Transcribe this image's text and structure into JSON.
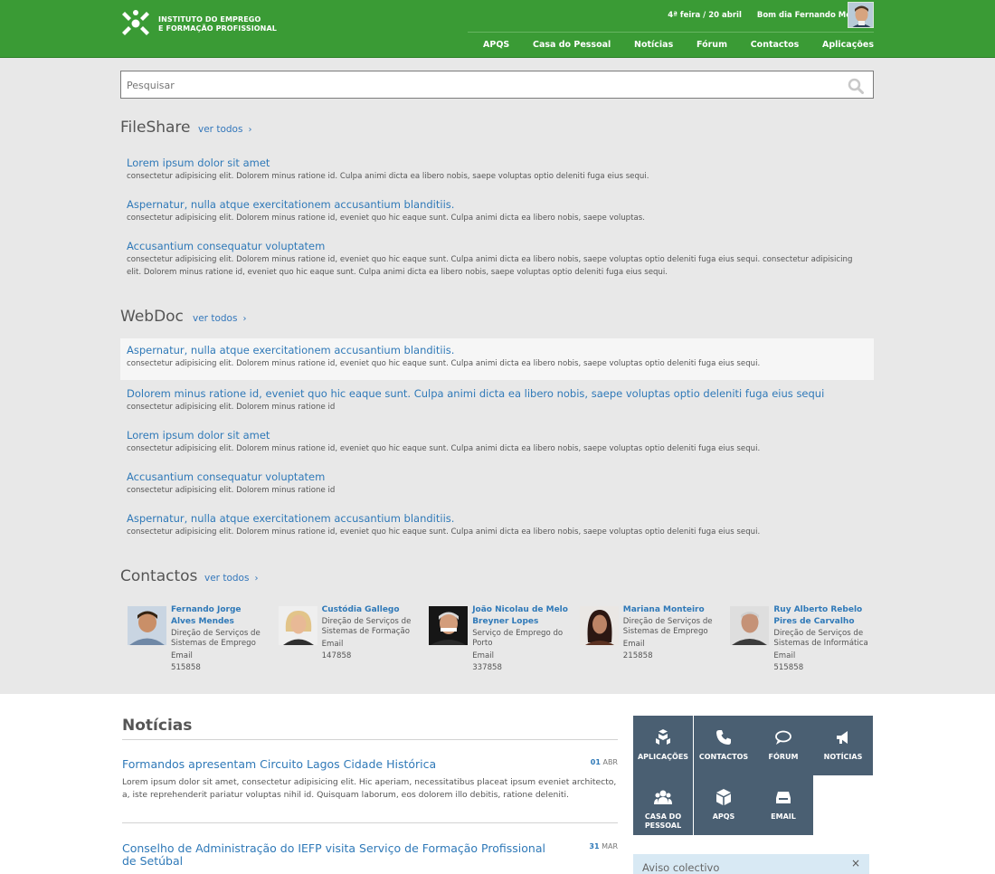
{
  "header": {
    "logo_line_1": "INSTITUTO DO EMPREGO",
    "logo_line_2": "E FORMAÇÃO PROFISSIONAL",
    "date": "4ª feira / 20 abril",
    "greeting": "Bom dia Fernando Mendes",
    "nav": [
      "APQS",
      "Casa do Pessoal",
      "Notícias",
      "Fórum",
      "Contactos",
      "Aplicações"
    ],
    "brand_color": "#3a9b35"
  },
  "search": {
    "placeholder": "Pesquisar"
  },
  "fileshare": {
    "title": "FileShare",
    "view_all": "ver todos",
    "items": [
      {
        "title": "Lorem ipsum dolor sit amet",
        "desc": "consectetur adipisicing elit. Dolorem minus ratione id. Culpa animi dicta ea libero nobis, saepe voluptas optio deleniti fuga eius sequi."
      },
      {
        "title": "Aspernatur, nulla atque exercitationem accusantium blanditiis.",
        "desc": "consectetur adipisicing elit. Dolorem minus ratione id, eveniet quo hic eaque sunt. Culpa animi dicta ea libero nobis, saepe voluptas."
      },
      {
        "title": "Accusantium consequatur voluptatem",
        "desc": "consectetur adipisicing elit. Dolorem minus ratione id, eveniet quo hic eaque sunt. Culpa animi dicta ea libero nobis, saepe voluptas optio deleniti fuga eius sequi. consectetur adipisicing elit. Dolorem minus ratione id, eveniet quo hic eaque sunt. Culpa animi dicta ea libero nobis, saepe voluptas optio deleniti fuga eius sequi."
      }
    ]
  },
  "webdoc": {
    "title": "WebDoc",
    "view_all": "ver todos",
    "items": [
      {
        "title": "Aspernatur, nulla atque exercitationem accusantium blanditiis.",
        "desc": "consectetur adipisicing elit. Dolorem minus ratione id, eveniet quo hic eaque sunt. Culpa animi dicta ea libero nobis, saepe voluptas optio deleniti fuga eius sequi."
      },
      {
        "title": "Dolorem minus ratione id, eveniet quo hic eaque sunt. Culpa animi dicta ea libero nobis, saepe voluptas optio deleniti fuga eius sequi",
        "desc": "consectetur adipisicing elit. Dolorem minus ratione id"
      },
      {
        "title": "Lorem ipsum dolor sit amet",
        "desc": "consectetur adipisicing elit. Dolorem minus ratione id, eveniet quo hic eaque sunt. Culpa animi dicta ea libero nobis, saepe voluptas optio deleniti fuga eius sequi."
      },
      {
        "title": "Accusantium consequatur voluptatem",
        "desc": "consectetur adipisicing elit. Dolorem minus ratione id"
      },
      {
        "title": "Aspernatur, nulla atque exercitationem accusantium blanditiis.",
        "desc": "consectetur adipisicing elit. Dolorem minus ratione id, eveniet quo hic eaque sunt. Culpa animi dicta ea libero nobis, saepe voluptas optio deleniti fuga eius sequi."
      }
    ]
  },
  "contacts": {
    "title": "Contactos",
    "view_all": "ver todos",
    "people": [
      {
        "name": "Fernando Jorge Alves Mendes",
        "dept": "Direção de Serviços de Sistemas de Emprego",
        "email": "Email",
        "phone": "515858"
      },
      {
        "name": "Custódia Gallego",
        "dept": "Direção de Serviços de Sistemas de Formação",
        "email": "Email",
        "phone": "147858"
      },
      {
        "name": "João Nicolau de Melo Breyner Lopes",
        "dept": "Serviço de Emprego do Porto",
        "email": "Email",
        "phone": "337858"
      },
      {
        "name": "Mariana Monteiro",
        "dept": "Direção de Serviços de Sistemas de Emprego",
        "email": "Email",
        "phone": "215858"
      },
      {
        "name": "Ruy Alberto Rebelo Pires de Carvalho",
        "dept": "Direção de Serviços de Sistemas de Informática",
        "email": "Email",
        "phone": "515858"
      }
    ]
  },
  "news": {
    "title": "Notícias",
    "items": [
      {
        "headline": "Formandos apresentam Circuito Lagos Cidade Histórica",
        "body": "Lorem ipsum dolor sit amet, consectetur adipisicing elit. Hic aperiam, necessitatibus placeat ipsum eveniet architecto, a, iste reprehenderit pariatur voluptas nihil id. Quisquam laborum, eos dolorem illo debitis, ratione deleniti.",
        "day": "01",
        "month": "ABR"
      },
      {
        "headline": "Conselho de Administração do IEFP visita Serviço de Formação Profissional de Setúbal",
        "day": "31",
        "month": "MAR"
      }
    ]
  },
  "quicklinks": {
    "tiles": [
      {
        "label": "APLICAÇÕES",
        "icon": "apps-icon"
      },
      {
        "label": "CONTACTOS",
        "icon": "phone-icon"
      },
      {
        "label": "FÓRUM",
        "icon": "chat-icon"
      },
      {
        "label": "NOTÍCIAS",
        "icon": "megaphone-icon"
      },
      {
        "label": "CASA DO PESSOAL",
        "icon": "people-icon"
      },
      {
        "label": "APQS",
        "icon": "box-icon"
      },
      {
        "label": "EMAIL",
        "icon": "inbox-icon"
      }
    ],
    "tile_color": "#4a5f72"
  },
  "notice": {
    "title": "Aviso colectivo",
    "close": "×"
  }
}
